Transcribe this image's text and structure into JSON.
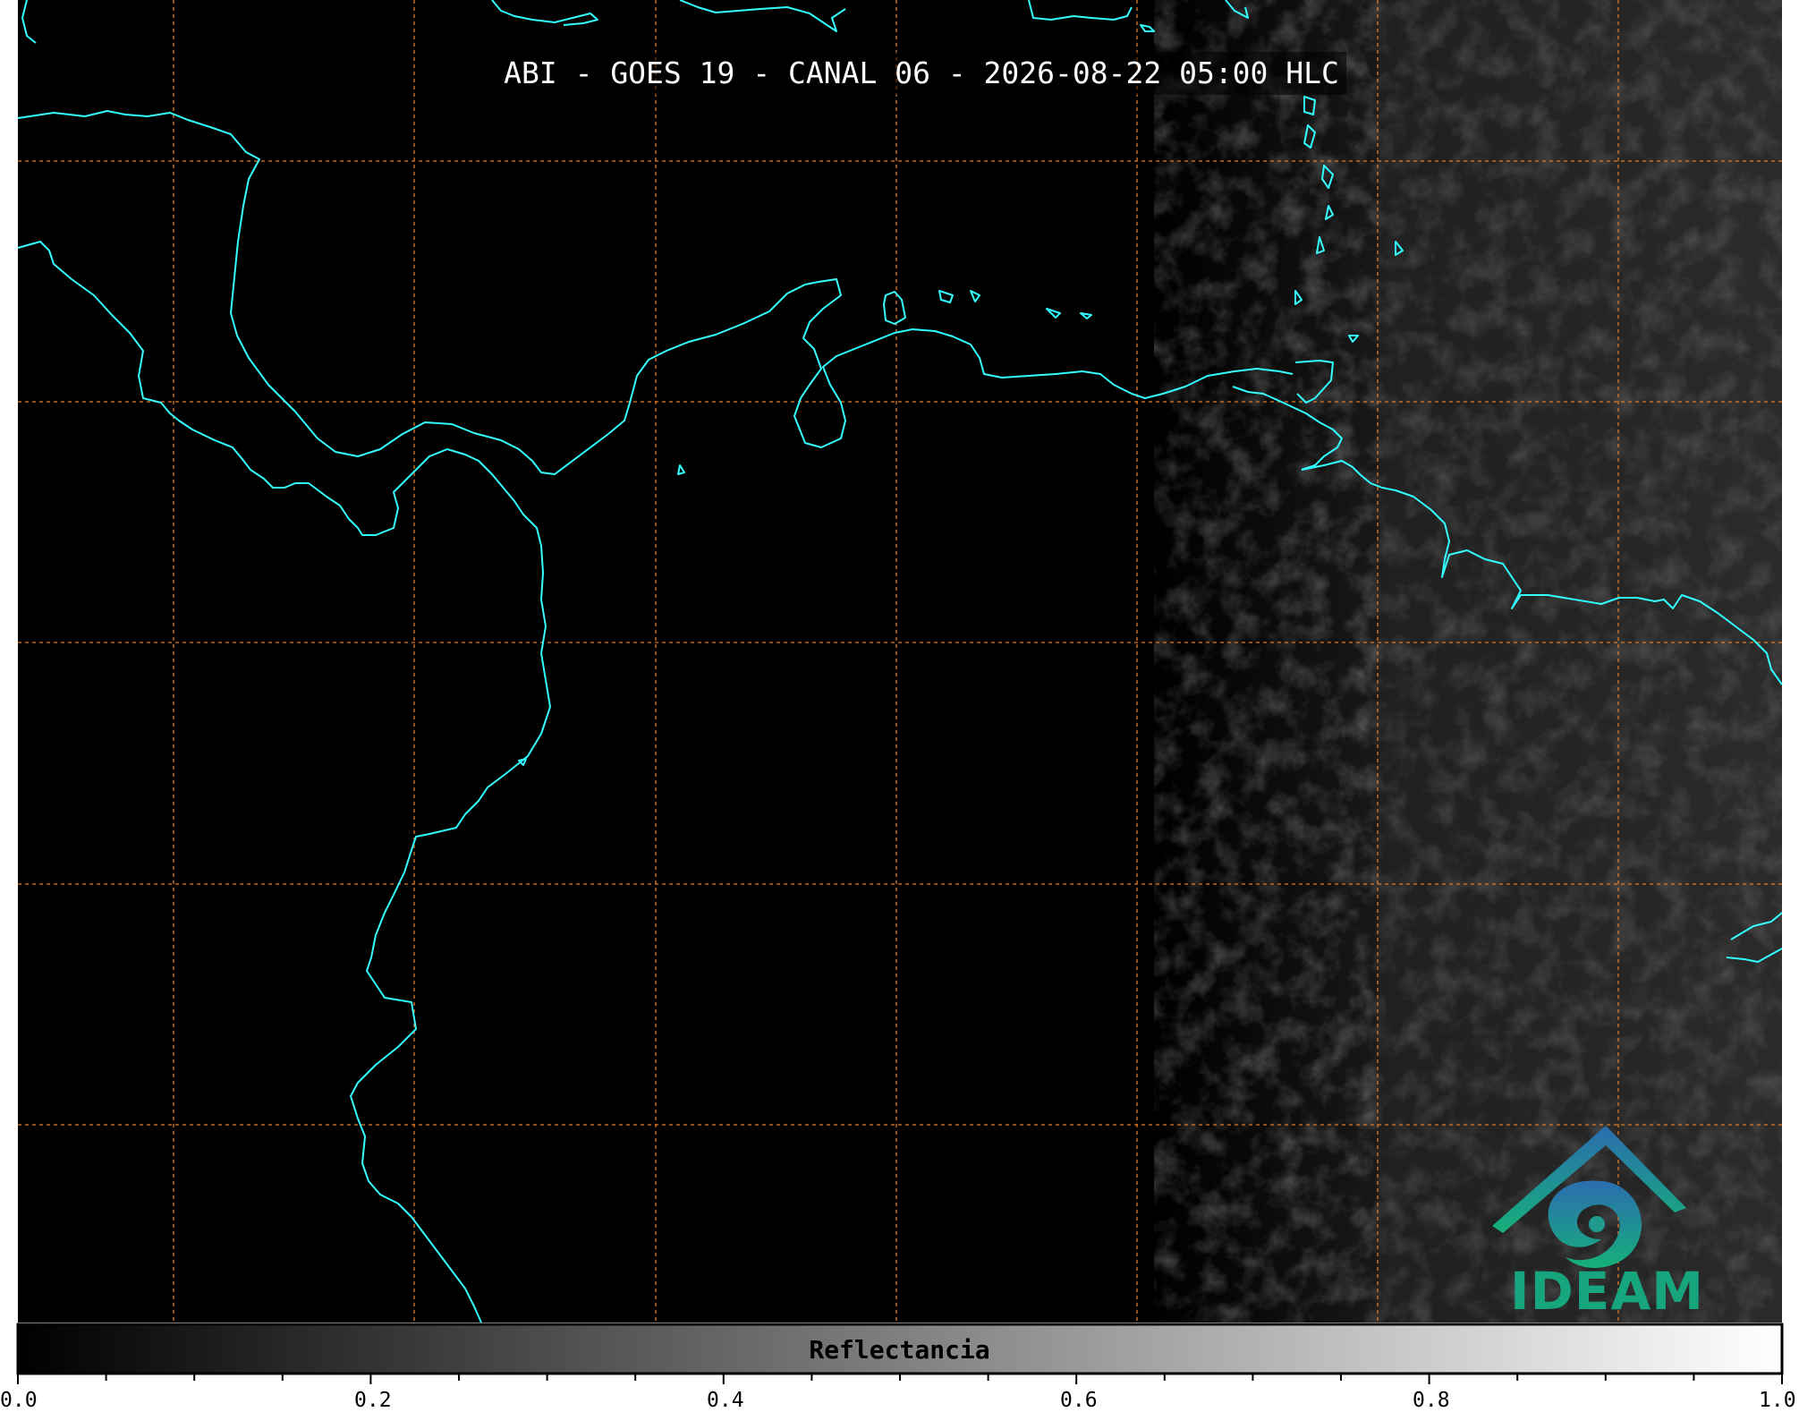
{
  "title": "ABI - GOES 19 - CANAL 06 - 2026-08-22 05:00 HLC",
  "logo": {
    "text": "IDEAM",
    "icon": "ideam-logo-icon"
  },
  "colorbar": {
    "label": "Reflectancia",
    "range": [
      0.0,
      1.0
    ],
    "ticks": [
      "0.0",
      "0.2",
      "0.4",
      "0.6",
      "0.8",
      "1.0"
    ],
    "colormap": "grayscale"
  },
  "map": {
    "coastline_color": "#33ffff",
    "gridline_color": "#e07a28",
    "gridline_style": "dashed",
    "background_color": "#000000"
  }
}
